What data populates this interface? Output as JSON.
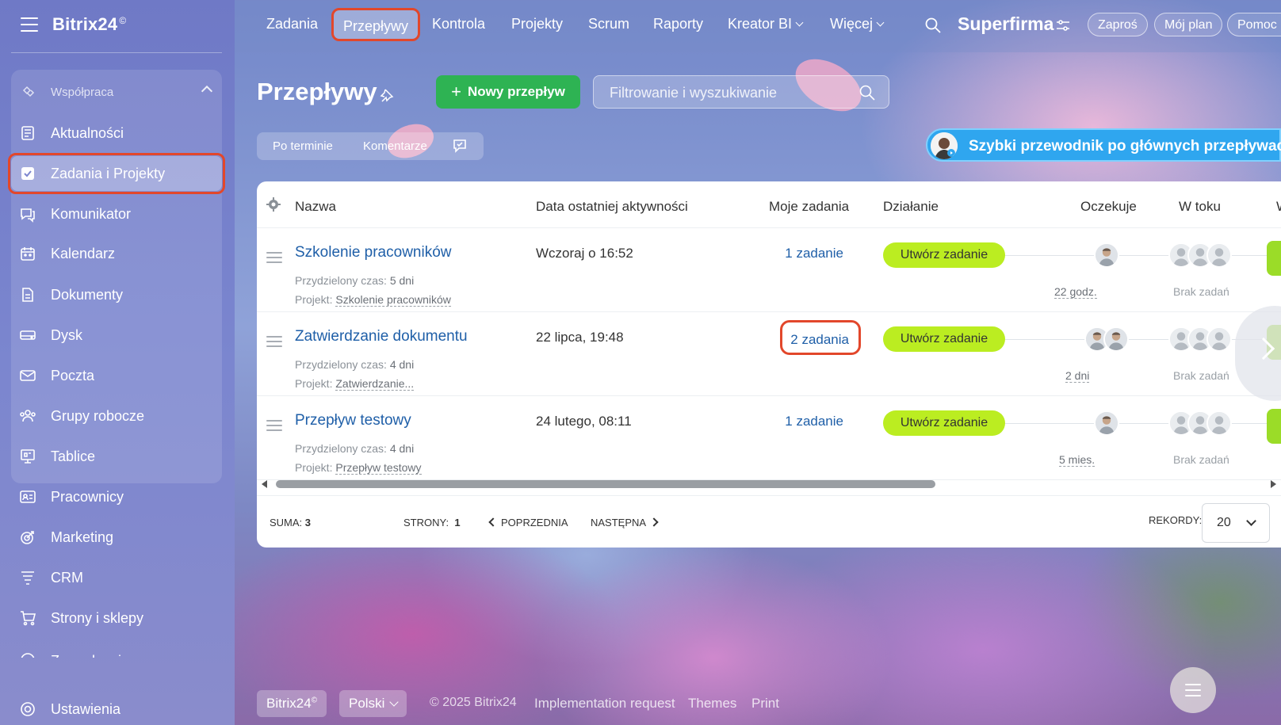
{
  "app": {
    "brand": "Bitrix24",
    "brand_mark": "©"
  },
  "sidebar": {
    "group_label": "Współpraca",
    "items": [
      {
        "label": "Aktualności",
        "icon": "newspaper-icon"
      },
      {
        "label": "Zadania i Projekty",
        "icon": "checkbox-icon",
        "active": true
      },
      {
        "label": "Komunikator",
        "icon": "chat-icon"
      },
      {
        "label": "Kalendarz",
        "icon": "calendar-icon"
      },
      {
        "label": "Dokumenty",
        "icon": "document-icon"
      },
      {
        "label": "Dysk",
        "icon": "drive-icon"
      },
      {
        "label": "Poczta",
        "icon": "mail-icon"
      },
      {
        "label": "Grupy robocze",
        "icon": "group-icon"
      },
      {
        "label": "Tablice",
        "icon": "board-icon"
      },
      {
        "label": "Pracownicy",
        "icon": "employees-icon"
      },
      {
        "label": "Marketing",
        "icon": "target-icon"
      },
      {
        "label": "CRM",
        "icon": "crm-funnel-icon"
      },
      {
        "label": "Strony i sklepy",
        "icon": "cart-icon"
      },
      {
        "label": "Zarządzanie ...",
        "icon": "inventory-icon"
      }
    ],
    "settings_label": "Ustawienia"
  },
  "topnav": {
    "items": [
      {
        "label": "Zadania"
      },
      {
        "label": "Przepływy",
        "active": true
      },
      {
        "label": "Kontrola"
      },
      {
        "label": "Projekty"
      },
      {
        "label": "Scrum"
      },
      {
        "label": "Raporty"
      },
      {
        "label": "Kreator BI",
        "dropdown": true
      },
      {
        "label": "Więcej",
        "dropdown": true
      }
    ],
    "company": "Superfirma",
    "invite": "Zaproś",
    "plan": "Mój plan",
    "help": "Pomoc"
  },
  "page": {
    "title": "Przepływy",
    "new_button": "Nowy przepływ",
    "filter_placeholder": "Filtrowanie i wyszukiwanie",
    "chips": [
      "Po terminie",
      "Komentarze"
    ],
    "guide": "Szybki przewodnik po głównych przepływach"
  },
  "table": {
    "columns": {
      "name": "Nazwa",
      "last_activity": "Data ostatniej aktywności",
      "my_tasks": "Moje zadania",
      "action": "Działanie",
      "waiting": "Oczekuje",
      "in_progress": "W toku",
      "cut": "W"
    },
    "rows": [
      {
        "name": "Szkolenie pracowników",
        "time_label": "Przydzielony czas:",
        "time": "5 dni",
        "project_label": "Projekt:",
        "project": "Szkolenie pracowników",
        "date": "Wczoraj o 16:52",
        "tasks": "1 zadanie",
        "action": "Utwórz zadanie",
        "waiting": "22 godz.",
        "in_progress": "Brak zadań"
      },
      {
        "name": "Zatwierdzanie dokumentu",
        "time_label": "Przydzielony czas:",
        "time": "4 dni",
        "project_label": "Projekt:",
        "project": "Zatwierdzanie...",
        "date": "22 lipca, 19:48",
        "tasks": "2 zadania",
        "action": "Utwórz zadanie",
        "waiting": "2 dni",
        "in_progress": "Brak zadań"
      },
      {
        "name": "Przepływ testowy",
        "time_label": "Przydzielony czas:",
        "time": "4 dni",
        "project_label": "Projekt:",
        "project": "Przepływ testowy",
        "date": "24 lutego, 08:11",
        "tasks": "1 zadanie",
        "action": "Utwórz zadanie",
        "waiting": "5 mies.",
        "in_progress": "Brak zadań"
      }
    ],
    "footer": {
      "total_label": "SUMA:",
      "total": "3",
      "pages_label": "STRONY:",
      "pages": "1",
      "prev": "POPRZEDNIA",
      "next": "NASTĘPNA",
      "records_label": "REKORDY:",
      "records": "20"
    }
  },
  "bottom": {
    "brand": "Bitrix24",
    "brand_mark": "©",
    "language": "Polski",
    "copyright": "© 2025 Bitrix24",
    "links": [
      "Implementation request",
      "Themes",
      "Print"
    ]
  },
  "colors": {
    "accent_green": "#2eb353",
    "action_lime": "#bbed21",
    "link_blue": "#1f5fa8",
    "highlight_red": "#e2472b",
    "guide_blue": "#2fa6ef"
  }
}
